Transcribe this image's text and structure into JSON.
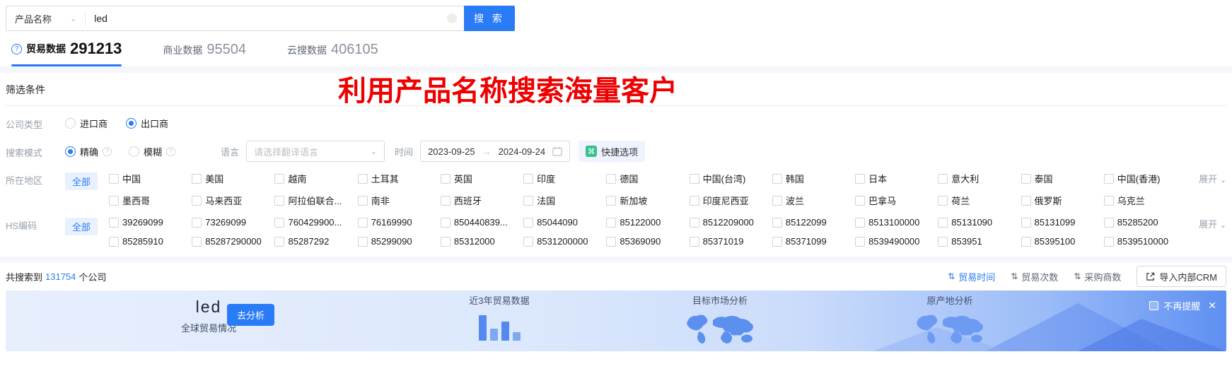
{
  "colors": {
    "primary": "#2a7bf6",
    "accent_red": "#ee0000",
    "quick_icon_green": "#35c08e",
    "banner_deep_blue": "#5e8ff1"
  },
  "search_bar": {
    "category": "产品名称",
    "query": "led",
    "search_button": "搜 索"
  },
  "tabs": [
    {
      "label": "贸易数据",
      "count": "291213",
      "active": true
    },
    {
      "label": "商业数据",
      "count": "95504",
      "active": false
    },
    {
      "label": "云搜数据",
      "count": "406105",
      "active": false
    }
  ],
  "overlay_title": "利用产品名称搜索海量客户",
  "filter": {
    "title": "筛选条件",
    "company_type": {
      "label": "公司类型",
      "options": [
        {
          "label": "进口商",
          "checked": false
        },
        {
          "label": "出口商",
          "checked": true
        }
      ]
    },
    "search_mode": {
      "label": "搜索模式",
      "options": [
        {
          "label": "精确",
          "checked": true
        },
        {
          "label": "模糊",
          "checked": false
        }
      ]
    },
    "language": {
      "label": "语言",
      "placeholder": "请选择翻译语言"
    },
    "time": {
      "label": "时间",
      "start": "2023-09-25",
      "arrow": "→",
      "end": "2024-09-24"
    },
    "quick_button": "快捷选项",
    "region": {
      "label": "所在地区",
      "all": "全部",
      "expand": "展开",
      "items": [
        "中国",
        "美国",
        "越南",
        "土耳其",
        "英国",
        "印度",
        "德国",
        "中国(台湾)",
        "韩国",
        "日本",
        "意大利",
        "泰国",
        "中国(香港)",
        "墨西哥",
        "马来西亚",
        "阿拉伯联合...",
        "南非",
        "西班牙",
        "法国",
        "新加坡",
        "印度尼西亚",
        "波兰",
        "巴拿马",
        "荷兰",
        "俄罗斯",
        "乌克兰"
      ]
    },
    "hs_code": {
      "label": "HS编码",
      "all": "全部",
      "expand": "展开",
      "items": [
        "39269099",
        "73269099",
        "760429900...",
        "76169990",
        "850440839...",
        "85044090",
        "85122000",
        "8512209000",
        "85122099",
        "8513100000",
        "85131090",
        "85131099",
        "85285200",
        "85285910",
        "85287290000",
        "85287292",
        "85299090",
        "85312000",
        "8531200000",
        "85369090",
        "85371019",
        "85371099",
        "8539490000",
        "853951",
        "85395100",
        "8539510000"
      ]
    }
  },
  "results": {
    "prefix": "共搜索到",
    "count": "131754",
    "suffix": "个公司",
    "sorts": [
      {
        "label": "贸易时间",
        "active": true
      },
      {
        "label": "贸易次数",
        "active": false
      },
      {
        "label": "采购商数",
        "active": false
      }
    ],
    "crm_button": "导入内部CRM"
  },
  "banner": {
    "keyword": "led",
    "subtitle": "全球贸易情况",
    "analyze_button": "去分析",
    "cards": [
      "近3年贸易数据",
      "目标市场分析",
      "原产地分析"
    ],
    "dismiss": "不再提醒"
  }
}
